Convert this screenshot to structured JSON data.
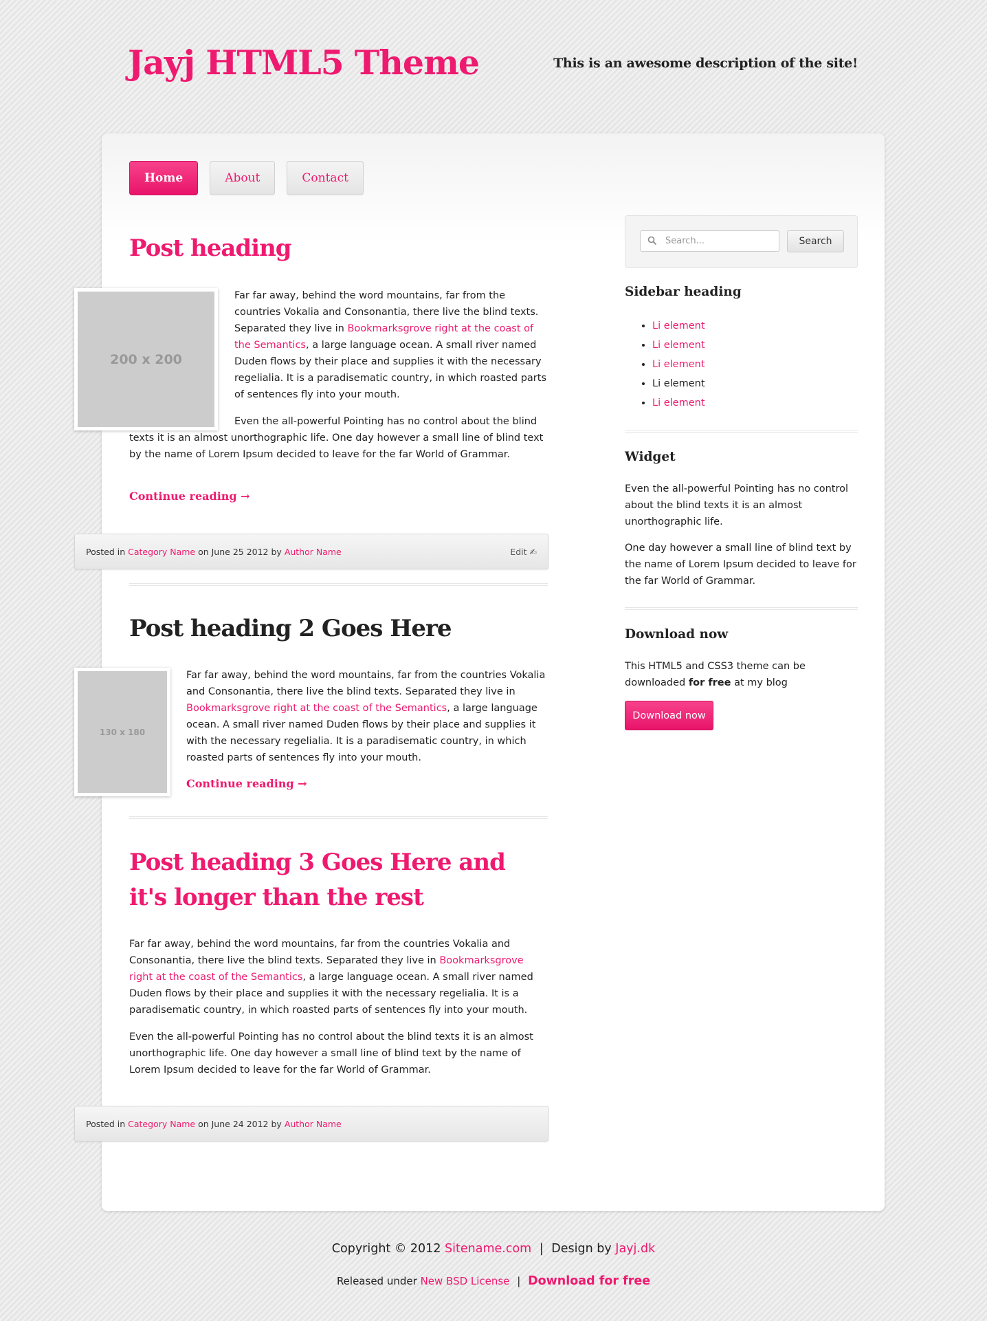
{
  "header": {
    "title": "Jayj HTML5 Theme",
    "description": "This is an awesome description of the site!"
  },
  "nav": [
    {
      "label": "Home",
      "active": true
    },
    {
      "label": "About",
      "active": false
    },
    {
      "label": "Contact",
      "active": false
    }
  ],
  "posts": [
    {
      "title": "Post heading",
      "thumb_label": "200 x 200",
      "p1_before": "Far far away, behind the word mountains, far from the countries Vokalia and Consonantia, there live the blind texts. Separated they live in ",
      "p1_link": "Bookmarksgrove right at the coast of the Semantics",
      "p1_after": ", a large language ocean. A small river named Duden flows by their place and supplies it with the necessary regelialia. It is a paradisematic country, in which roasted parts of sentences fly into your mouth.",
      "p2": "Even the all-powerful Pointing has no control about the blind texts it is an almost unorthographic life. One day however a small line of blind text by the name of Lorem Ipsum decided to leave for the far World of Grammar.",
      "continue": "Continue reading →",
      "meta": {
        "posted_in": "Posted in",
        "category": "Category Name",
        "on": "on June 25 2012 by",
        "author": "Author Name",
        "edit": "Edit ✍"
      }
    },
    {
      "title": "Post heading 2 Goes Here",
      "thumb_label": "130 x 180",
      "p1_before": "Far far away, behind the word mountains, far from the countries Vokalia and Consonantia, there live the blind texts. Separated they live in ",
      "p1_link": "Bookmarksgrove right at the coast of the Semantics",
      "p1_after": ", a large language ocean. A small river named Duden flows by their place and supplies it with the necessary regelialia. It is a paradisematic country, in which roasted parts of sentences fly into your mouth.",
      "continue": "Continue reading →"
    },
    {
      "title": "Post heading 3 Goes Here and it's longer than the rest",
      "p1_before": "Far far away, behind the word mountains, far from the countries Vokalia and Consonantia, there live the blind texts. Separated they live in ",
      "p1_link": "Bookmarksgrove right at the coast of the Semantics",
      "p1_after": ", a large language ocean. A small river named Duden flows by their place and supplies it with the necessary regelialia. It is a paradisematic country, in which roasted parts of sentences fly into your mouth.",
      "p2": "Even the all-powerful Pointing has no control about the blind texts it is an almost unorthographic life. One day however a small line of blind text by the name of Lorem Ipsum decided to leave for the far World of Grammar.",
      "meta": {
        "posted_in": "Posted in",
        "category": "Category Name",
        "on": "on June 24 2012 by",
        "author": "Author Name"
      }
    }
  ],
  "sidebar": {
    "search_placeholder": "Search...",
    "search_button": "Search",
    "list_heading": "Sidebar heading",
    "list_items": [
      {
        "label": "Li element",
        "link": true
      },
      {
        "label": "Li element",
        "link": true
      },
      {
        "label": "Li element",
        "link": true
      },
      {
        "label": "Li element",
        "link": false
      },
      {
        "label": "Li element",
        "link": true
      }
    ],
    "widget_heading": "Widget",
    "widget_p1": "Even the all-powerful Pointing has no control about the blind texts it is an almost unorthographic life.",
    "widget_p2": "One day however a small line of blind text by the name of Lorem Ipsum decided to leave for the far World of Grammar.",
    "download_heading": "Download now",
    "download_text_before": "This HTML5 and CSS3 theme can be downloaded ",
    "download_text_bold": "for free",
    "download_text_after": " at my blog",
    "download_button": "Download now"
  },
  "footer": {
    "copyright": "Copyright © 2012",
    "sitename": "Sitename.com",
    "design_by": "Design by",
    "designer": "Jayj.dk",
    "released": "Released under",
    "license": "New BSD License",
    "download_free": "Download for free",
    "separator": "|"
  },
  "colors": {
    "accent": "#ee1a6f",
    "background": "#e9e9e9",
    "card": "#ffffff"
  }
}
